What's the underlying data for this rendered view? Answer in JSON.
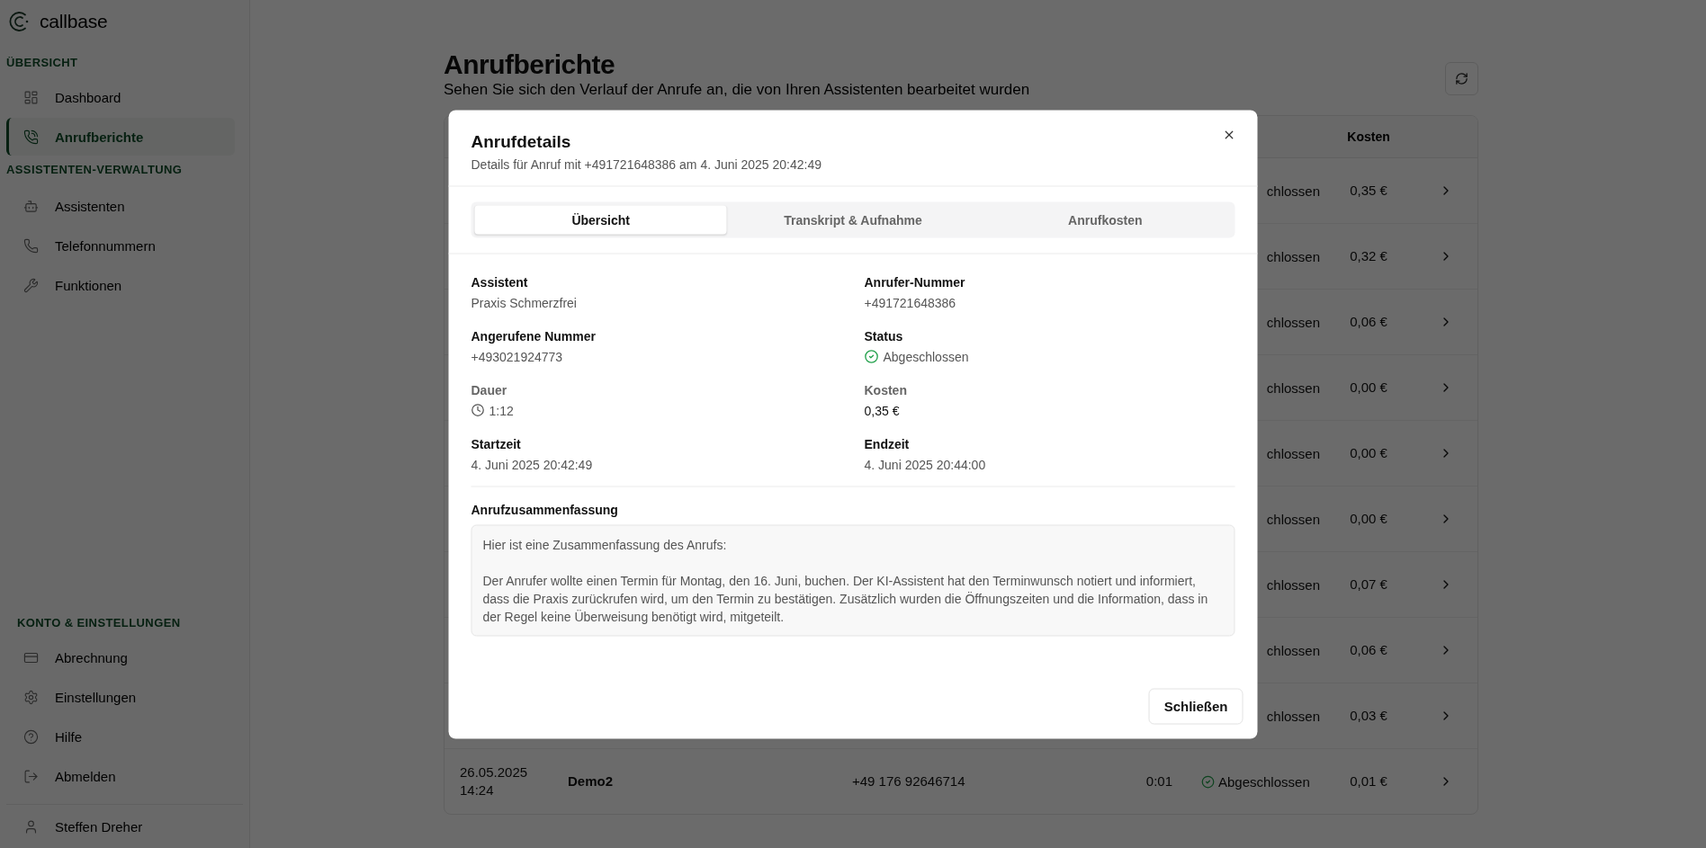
{
  "sidebar": {
    "logo": "callbase",
    "sections": [
      {
        "title": "ÜBERSICHT",
        "items": [
          {
            "label": "Dashboard",
            "selected": false
          },
          {
            "label": "Anrufberichte",
            "selected": true
          }
        ]
      },
      {
        "title": "ASSISTENTEN-VERWALTUNG",
        "items": [
          {
            "label": "Assistenten",
            "selected": false
          },
          {
            "label": "Telefonnummern",
            "selected": false
          },
          {
            "label": "Funktionen",
            "selected": false
          }
        ]
      },
      {
        "title": "KONTO & EINSTELLUNGEN",
        "items": [
          {
            "label": "Abrechnung",
            "selected": false
          },
          {
            "label": "Einstellungen",
            "selected": false
          },
          {
            "label": "Hilfe",
            "selected": false
          },
          {
            "label": "Abmelden",
            "selected": false
          }
        ]
      }
    ],
    "user": {
      "name": "Steffen Dreher"
    }
  },
  "page": {
    "title": "Anrufberichte",
    "subtitle": "Sehen Sie sich den Verlauf der Anrufe an, die von Ihren Assistenten bearbeitet wurden"
  },
  "table": {
    "cost_heading": "Kosten",
    "rows": [
      {
        "kind": "partial",
        "status": "chlossen",
        "cost": "0,35 €"
      },
      {
        "kind": "partial",
        "status": "chlossen",
        "cost": "0,32 €"
      },
      {
        "kind": "partial",
        "status": "chlossen",
        "cost": "0,06 €"
      },
      {
        "kind": "partial",
        "status": "chlossen",
        "cost": "0,00 €"
      },
      {
        "kind": "partial",
        "status": "chlossen",
        "cost": "0,00 €"
      },
      {
        "kind": "partial",
        "status": "chlossen",
        "cost": "0,00 €"
      },
      {
        "kind": "partial",
        "status": "chlossen",
        "cost": "0,07 €"
      },
      {
        "kind": "partial",
        "status": "chlossen",
        "cost": "0,06 €"
      },
      {
        "kind": "partial",
        "status": "chlossen",
        "cost": "0,03 €"
      },
      {
        "kind": "full",
        "date": "26.05.2025",
        "time": "14:24",
        "assistant": "Demo2",
        "number": "+49 176 92646714",
        "duration": "0:01",
        "status": "Abgeschlossen",
        "cost": "0,01 €"
      }
    ]
  },
  "dialog": {
    "title": "Anrufdetails",
    "subtitle": "Details für Anruf mit +491721648386 am 4. Juni 2025 20:42:49",
    "tabs": [
      {
        "label": "Übersicht",
        "selected": true
      },
      {
        "label": "Transkript & Aufnahme",
        "selected": false
      },
      {
        "label": "Anrufkosten",
        "selected": false
      }
    ],
    "fields": [
      {
        "kind": "text",
        "label": "Assistent",
        "value": "Praxis Schmerzfrei"
      },
      {
        "kind": "text",
        "label": "Anrufer-Nummer",
        "value": "+491721648386"
      },
      {
        "kind": "text",
        "label": "Angerufene Nummer",
        "value": "+493021924773"
      },
      {
        "kind": "status",
        "label": "Status",
        "value": "Abgeschlossen"
      },
      {
        "kind": "duration",
        "label": "Dauer",
        "value": "1:12"
      },
      {
        "kind": "amount",
        "label": "Kosten",
        "value": "0,35 €"
      },
      {
        "kind": "text",
        "label": "Startzeit",
        "value": "4. Juni 2025 20:42:49"
      },
      {
        "kind": "text",
        "label": "Endzeit",
        "value": "4. Juni 2025 20:44:00"
      }
    ],
    "summary": {
      "title": "Anrufzusammenfassung",
      "paragraphs": [
        "Hier ist eine Zusammenfassung des Anrufs:",
        "Der Anrufer wollte einen Termin für Montag, den 16. Juni, buchen. Der KI-Assistent hat den Terminwunsch notiert und informiert, dass die Praxis zurückrufen wird, um den Termin zu bestätigen. Zusätzlich wurden die Öffnungszeiten und die Information, dass in der Regel keine Überweisung benötigt wird, mitgeteilt."
      ]
    },
    "close_button": "Schließen"
  }
}
